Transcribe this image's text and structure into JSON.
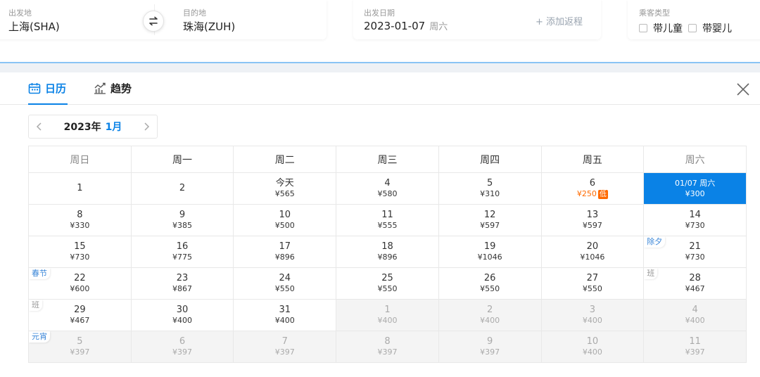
{
  "search": {
    "origin_label": "出发地",
    "origin_value": "上海(SHA)",
    "destination_label": "目的地",
    "destination_value": "珠海(ZUH)",
    "date_label": "出发日期",
    "date_value": "2023-01-07",
    "date_weekday": "周六",
    "add_return": "+ 添加返程",
    "passenger_label": "乘客类型",
    "child_label": "带儿童",
    "infant_label": "带婴儿"
  },
  "tabs": {
    "calendar": "日历",
    "trend": "趋势"
  },
  "month": {
    "year": "2023年",
    "month": "1月"
  },
  "weekdays": [
    "周日",
    "周一",
    "周二",
    "周三",
    "周四",
    "周五",
    "周六"
  ],
  "rows": [
    [
      {
        "day": "1",
        "price": ""
      },
      {
        "day": "2",
        "price": ""
      },
      {
        "day": "今天",
        "price": "¥565"
      },
      {
        "day": "4",
        "price": "¥580"
      },
      {
        "day": "5",
        "price": "¥310"
      },
      {
        "day": "6",
        "price": "¥250",
        "low": true,
        "badge": "低"
      },
      {
        "day": "01/07 周六",
        "price": "¥300",
        "selected": true
      }
    ],
    [
      {
        "day": "8",
        "price": "¥330"
      },
      {
        "day": "9",
        "price": "¥385"
      },
      {
        "day": "10",
        "price": "¥500"
      },
      {
        "day": "11",
        "price": "¥555"
      },
      {
        "day": "12",
        "price": "¥597"
      },
      {
        "day": "13",
        "price": "¥597"
      },
      {
        "day": "14",
        "price": "¥730"
      }
    ],
    [
      {
        "day": "15",
        "price": "¥730"
      },
      {
        "day": "16",
        "price": "¥775"
      },
      {
        "day": "17",
        "price": "¥896"
      },
      {
        "day": "18",
        "price": "¥896"
      },
      {
        "day": "19",
        "price": "¥1046"
      },
      {
        "day": "20",
        "price": "¥1046"
      },
      {
        "day": "21",
        "price": "¥730",
        "tag": "除夕"
      }
    ],
    [
      {
        "day": "22",
        "price": "¥600",
        "tag": "春节"
      },
      {
        "day": "23",
        "price": "¥867"
      },
      {
        "day": "24",
        "price": "¥550"
      },
      {
        "day": "25",
        "price": "¥550"
      },
      {
        "day": "26",
        "price": "¥550"
      },
      {
        "day": "27",
        "price": "¥550"
      },
      {
        "day": "28",
        "price": "¥467",
        "tag": "班",
        "tagwork": true
      }
    ],
    [
      {
        "day": "29",
        "price": "¥467",
        "tag": "班",
        "tagwork": true
      },
      {
        "day": "30",
        "price": "¥400"
      },
      {
        "day": "31",
        "price": "¥400"
      },
      {
        "day": "1",
        "price": "¥400",
        "other": true
      },
      {
        "day": "2",
        "price": "¥400",
        "other": true
      },
      {
        "day": "3",
        "price": "¥400",
        "other": true
      },
      {
        "day": "4",
        "price": "¥400",
        "other": true
      }
    ],
    [
      {
        "day": "5",
        "price": "¥397",
        "other": true,
        "tag": "元宵"
      },
      {
        "day": "6",
        "price": "¥397",
        "other": true
      },
      {
        "day": "7",
        "price": "¥397",
        "other": true
      },
      {
        "day": "8",
        "price": "¥397",
        "other": true
      },
      {
        "day": "9",
        "price": "¥397",
        "other": true
      },
      {
        "day": "10",
        "price": "¥400",
        "other": true
      },
      {
        "day": "11",
        "price": "¥397",
        "other": true
      }
    ]
  ],
  "colors": {
    "accent": "#0a82e6",
    "low_price": "#ff6a00",
    "holiday_tag": "#3a86d8"
  },
  "icons": {
    "swap": "swap-arrows-icon",
    "calendar": "calendar-icon",
    "trend": "trend-chart-icon",
    "close": "close-icon",
    "prev": "chevron-left-icon",
    "next": "chevron-right-icon"
  }
}
